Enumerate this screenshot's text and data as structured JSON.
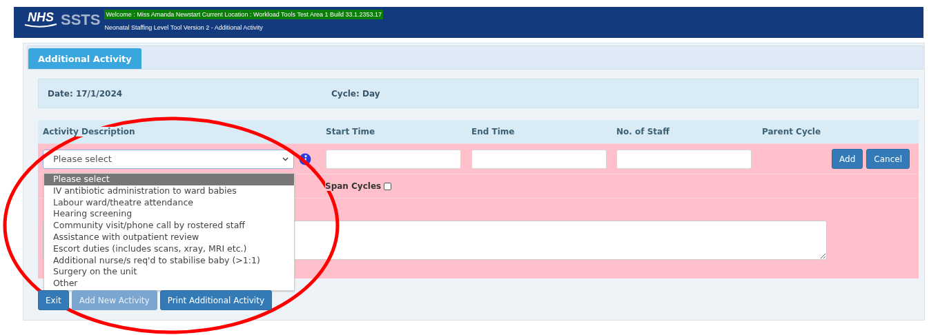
{
  "header": {
    "logo": "NHS",
    "brand": "SSTS",
    "welcome": "Welcome : Miss Amanda Newstart Current Location : Workload Tools Test Area 1 Build 33.1.2353.17",
    "subtitle": "Neonatal Staffing Level Tool Version 2 - Additional Activity"
  },
  "tabs": [
    {
      "label": "Additional Activity",
      "selected": true
    }
  ],
  "info": {
    "date": "Date: 17/1/2024",
    "cycle": "Cycle: Day"
  },
  "table": {
    "columns": [
      "Activity Description",
      "Start Time",
      "End Time",
      "No. of Staff",
      "Parent Cycle"
    ]
  },
  "form": {
    "select": {
      "value": "Please select",
      "expanded": true,
      "options": [
        {
          "label": "Please select",
          "selected": true
        },
        {
          "label": "IV antibiotic administration to ward babies",
          "selected": false
        },
        {
          "label": "Labour ward/theatre attendance",
          "selected": false
        },
        {
          "label": "Hearing screening",
          "selected": false
        },
        {
          "label": "Community visit/phone call by rostered staff",
          "selected": false
        },
        {
          "label": "Assistance with outpatient review",
          "selected": false
        },
        {
          "label": "Escort duties (includes scans, xray, MRI etc.)",
          "selected": false
        },
        {
          "label": "Additional nurse/s req'd to stabilise baby (>1:1)",
          "selected": false
        },
        {
          "label": "Surgery on the unit",
          "selected": false
        },
        {
          "label": "Other",
          "selected": false
        }
      ]
    },
    "span_cycles": {
      "label": "Span Cycles",
      "checked": false
    },
    "row_buttons": [
      "Add",
      "Cancel"
    ]
  },
  "buttons": [
    {
      "label": "Exit",
      "disabled": false
    },
    {
      "label": "Add New Activity",
      "disabled": true
    },
    {
      "label": "Print Additional Activity",
      "disabled": false
    }
  ],
  "annotation": {
    "kind": "ellipse"
  }
}
